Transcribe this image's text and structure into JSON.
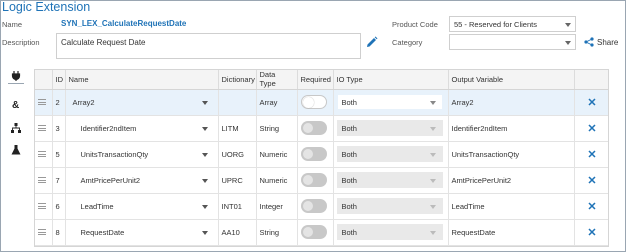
{
  "page": {
    "title": "Logic Extension"
  },
  "form": {
    "name_label": "Name",
    "name_value": "SYN_LEX_CalculateRequestDate",
    "description_label": "Description",
    "description_value": "Calculate Request Date",
    "product_code_label": "Product Code",
    "product_code_value": "55 - Reserved for Clients",
    "category_label": "Category",
    "category_value": "",
    "share_label": "Share"
  },
  "toolbar": {
    "items": [
      {
        "icon": "plug-icon",
        "active": true
      },
      {
        "icon": "ampersand-icon",
        "active": false
      },
      {
        "icon": "hierarchy-icon",
        "active": false
      },
      {
        "icon": "flask-icon",
        "active": false
      }
    ]
  },
  "table": {
    "headers": [
      "",
      "ID",
      "Name",
      "Dictionary",
      "Data Type",
      "Required",
      "IO Type",
      "Output Variable",
      ""
    ],
    "rows": [
      {
        "id": "2",
        "name": "Array2",
        "dictionary": "",
        "data_type": "Array",
        "required": true,
        "io_type": "Both",
        "io_enabled": true,
        "output_variable": "Array2",
        "selected": true,
        "indent": false
      },
      {
        "id": "3",
        "name": "Identifier2ndItem",
        "dictionary": "LITM",
        "data_type": "String",
        "required": false,
        "io_type": "Both",
        "io_enabled": false,
        "output_variable": "Identifier2ndItem",
        "selected": false,
        "indent": true
      },
      {
        "id": "5",
        "name": "UnitsTransactionQty",
        "dictionary": "UORG",
        "data_type": "Numeric",
        "required": false,
        "io_type": "Both",
        "io_enabled": false,
        "output_variable": "UnitsTransactionQty",
        "selected": false,
        "indent": true
      },
      {
        "id": "7",
        "name": "AmtPricePerUnit2",
        "dictionary": "UPRC",
        "data_type": "Numeric",
        "required": false,
        "io_type": "Both",
        "io_enabled": false,
        "output_variable": "AmtPricePerUnit2",
        "selected": false,
        "indent": true
      },
      {
        "id": "6",
        "name": "LeadTime",
        "dictionary": "INT01",
        "data_type": "Integer",
        "required": false,
        "io_type": "Both",
        "io_enabled": false,
        "output_variable": "LeadTime",
        "selected": false,
        "indent": true
      },
      {
        "id": "8",
        "name": "RequestDate",
        "dictionary": "AA10",
        "data_type": "String",
        "required": false,
        "io_type": "Both",
        "io_enabled": false,
        "output_variable": "RequestDate",
        "selected": false,
        "indent": true
      }
    ]
  },
  "colors": {
    "accent": "#1f73b7",
    "selected_row": "#e8f2fb",
    "delete": "#1f73b7"
  }
}
